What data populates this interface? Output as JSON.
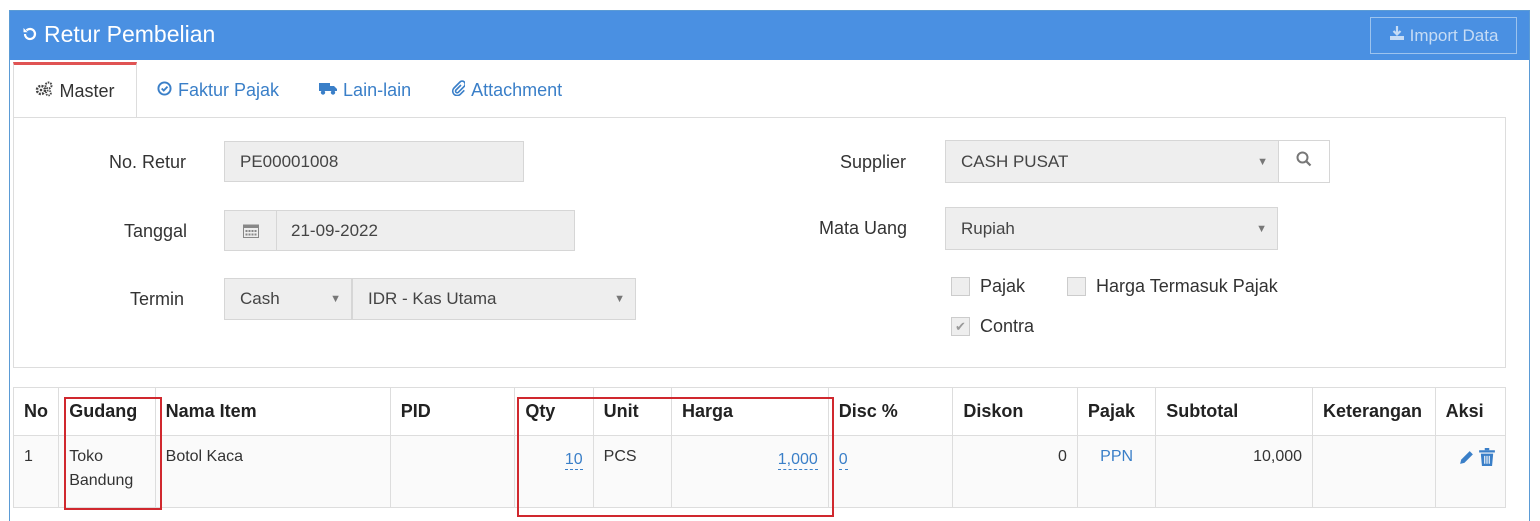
{
  "header": {
    "title": "Retur Pembelian",
    "import_label": "Import Data"
  },
  "tabs": [
    {
      "label": "Master",
      "icon": "gears-icon",
      "active": true
    },
    {
      "label": "Faktur Pajak",
      "icon": "check-circle-icon"
    },
    {
      "label": "Lain-lain",
      "icon": "truck-icon"
    },
    {
      "label": "Attachment",
      "icon": "paperclip-icon"
    }
  ],
  "form": {
    "no_retur_label": "No. Retur",
    "no_retur_value": "PE00001008",
    "tanggal_label": "Tanggal",
    "tanggal_value": "21-09-2022",
    "termin_label": "Termin",
    "termin_value": "Cash",
    "kas_value": "IDR - Kas Utama",
    "supplier_label": "Supplier",
    "supplier_value": "CASH PUSAT",
    "mata_uang_label": "Mata Uang",
    "mata_uang_value": "Rupiah",
    "pajak_label": "Pajak",
    "harga_termasuk_pajak_label": "Harga Termasuk Pajak",
    "contra_label": "Contra",
    "pajak_checked": false,
    "harga_termasuk_pajak_checked": false,
    "contra_checked": true
  },
  "table": {
    "headers": [
      "No",
      "Gudang",
      "Nama Item",
      "PID",
      "Qty",
      "Unit",
      "Harga",
      "Disc %",
      "Diskon",
      "Pajak",
      "Subtotal",
      "Keterangan",
      "Aksi"
    ],
    "rows": [
      {
        "no": "1",
        "gudang": "Toko Bandung",
        "nama_item": "Botol Kaca",
        "pid": "",
        "qty": "10",
        "unit": "PCS",
        "harga": "1,000",
        "disc": "0",
        "diskon": "0",
        "pajak": "PPN",
        "subtotal": "10,000",
        "keterangan": ""
      }
    ]
  },
  "colors": {
    "header_bg": "#4a90e2",
    "link": "#3a7fc8",
    "highlight": "#d0282e",
    "active_tab_top": "#e05353"
  }
}
